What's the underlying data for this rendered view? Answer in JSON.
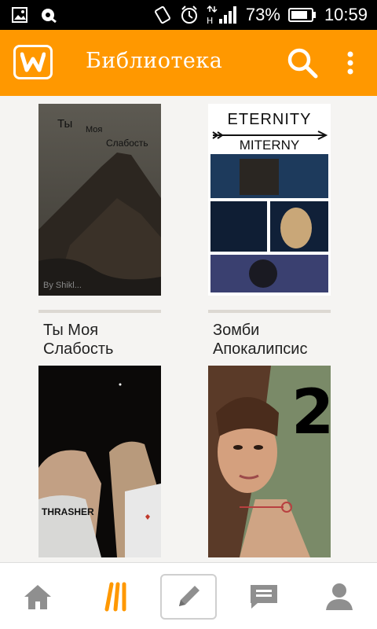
{
  "status_bar": {
    "battery": "73%",
    "time": "10:59",
    "network_label": "H",
    "icons": [
      "screenshot-icon",
      "media-icon",
      "rotate-icon",
      "alarm-icon",
      "signal-icon",
      "battery-icon"
    ]
  },
  "app_bar": {
    "title": "Библиотека",
    "logo_icon": "wattpad-logo-icon",
    "search_icon": "search-icon",
    "menu_icon": "overflow-menu-icon",
    "accent": "#ff9800"
  },
  "library": {
    "books": [
      {
        "title": "Ты Моя Слабость",
        "progress": 0,
        "cover_text": [
          "Ты",
          "Моя",
          "Слабость"
        ],
        "cover_caption": "By Shikl..."
      },
      {
        "title": "Зомби Апокалипсис",
        "progress": 0,
        "cover_text": [
          "ETERNITY",
          "MITERNY"
        ]
      },
      {
        "title": "",
        "progress": 0,
        "cover_text": [
          "THRASHER"
        ]
      },
      {
        "title": "",
        "progress": 0,
        "cover_text": [
          "2"
        ]
      }
    ]
  },
  "bottom_nav": {
    "items": [
      {
        "name": "home",
        "icon": "home-icon"
      },
      {
        "name": "library",
        "icon": "library-icon",
        "active": true
      },
      {
        "name": "write",
        "icon": "pencil-icon"
      },
      {
        "name": "messages",
        "icon": "chat-icon"
      },
      {
        "name": "profile",
        "icon": "profile-icon"
      }
    ]
  }
}
